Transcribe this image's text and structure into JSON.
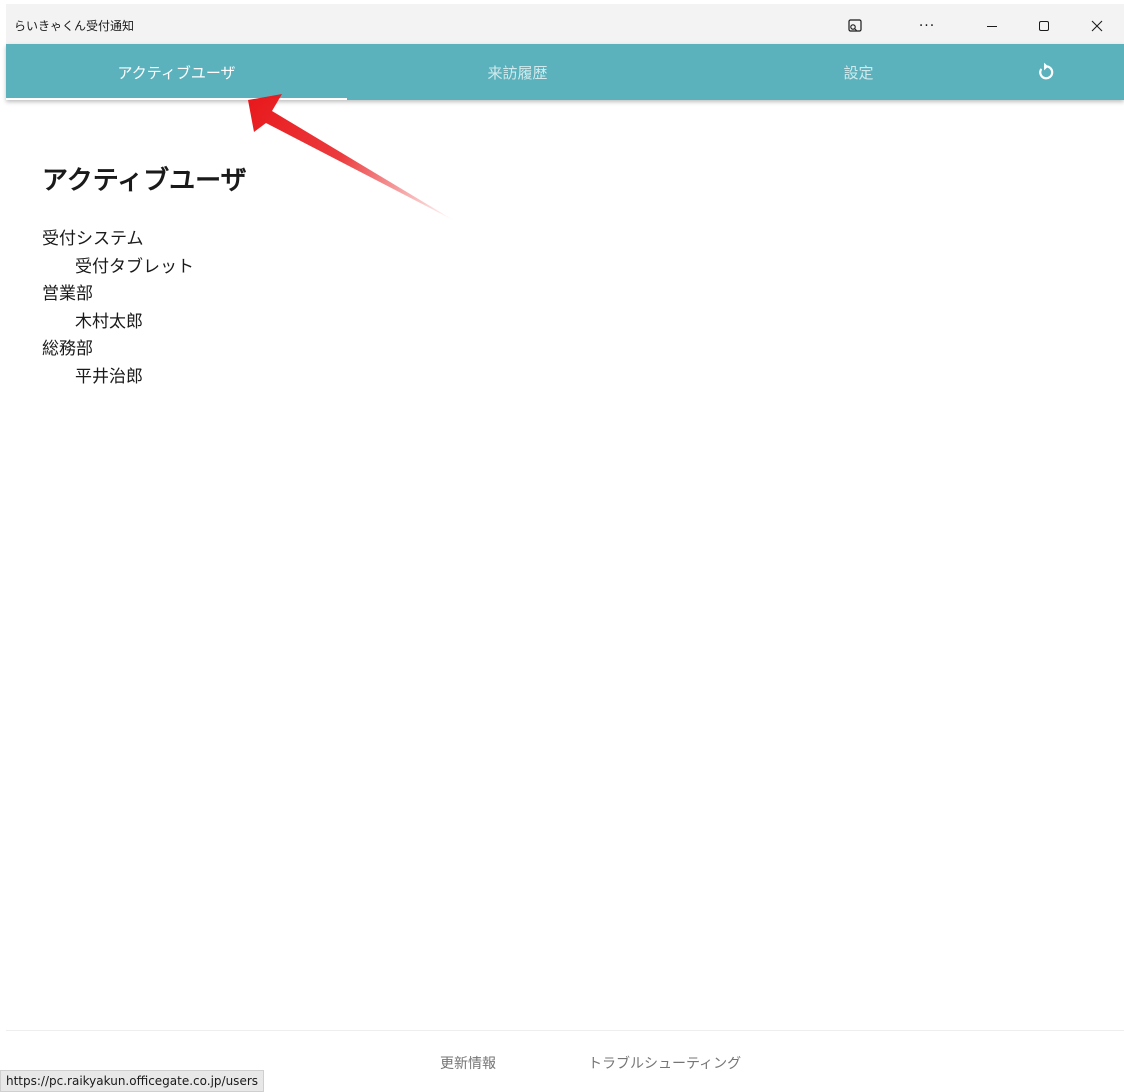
{
  "window": {
    "title": "らいきゃくん受付通知"
  },
  "titlebar_controls": {
    "cast_icon": "cast-icon",
    "more_label": "···",
    "minimize_icon": "minimize-icon",
    "maximize_icon": "maximize-icon",
    "close_icon": "close-icon"
  },
  "tabs": [
    {
      "label": "アクティブユーザ",
      "active": true
    },
    {
      "label": "来訪履歴",
      "active": false
    },
    {
      "label": "設定",
      "active": false
    }
  ],
  "reload_icon": "reload-icon",
  "main": {
    "title": "アクティブユーザ",
    "groups": [
      {
        "name": "受付システム",
        "members": [
          "受付タブレット"
        ]
      },
      {
        "name": "営業部",
        "members": [
          "木村太郎"
        ]
      },
      {
        "name": "総務部",
        "members": [
          "平井治郎"
        ]
      }
    ]
  },
  "footer": {
    "links": [
      "更新情報",
      "トラブルシューティング"
    ]
  },
  "status_bar": {
    "url": "https://pc.raikyakun.officegate.co.jp/users"
  },
  "colors": {
    "accent": "#5bb2bd",
    "annotation_arrow": "#e8191c"
  }
}
